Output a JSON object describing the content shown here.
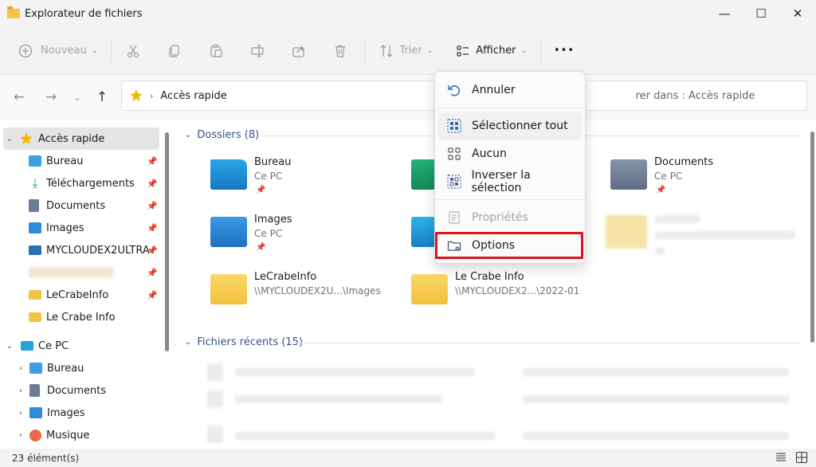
{
  "window": {
    "title": "Explorateur de fichiers",
    "minimize": "—",
    "maximize": "☐",
    "close": "✕"
  },
  "toolbar": {
    "new_label": "Nouveau",
    "sort_label": "Trier",
    "view_label": "Afficher",
    "more": "•••"
  },
  "address": {
    "path_label": "Accès rapide",
    "search_placeholder": "rer dans : Accès rapide"
  },
  "sidebar": {
    "quick_access": "Accès rapide",
    "quick_items": [
      {
        "label": "Bureau",
        "icon": "desktop-icon",
        "color": "#3aa0e0"
      },
      {
        "label": "Téléchargements",
        "icon": "download-icon",
        "color": "#1aa364"
      },
      {
        "label": "Documents",
        "icon": "document-icon",
        "color": "#6b7b95"
      },
      {
        "label": "Images",
        "icon": "images-icon",
        "color": "#2f8ad8"
      },
      {
        "label": "MYCLOUDEX2ULTRA",
        "icon": "network-drive-icon",
        "color": "#2a6fb5"
      },
      {
        "label": "",
        "icon": "folder-icon",
        "color": "#f6d36e"
      },
      {
        "label": "LeCrabeInfo",
        "icon": "folder-icon",
        "color": "#f6c343"
      },
      {
        "label": "Le Crabe Info",
        "icon": "folder-icon",
        "color": "#f6c343"
      }
    ],
    "this_pc": "Ce PC",
    "pc_items": [
      {
        "label": "Bureau",
        "icon": "desktop-icon",
        "color": "#3aa0e0"
      },
      {
        "label": "Documents",
        "icon": "document-icon",
        "color": "#6b7b95"
      },
      {
        "label": "Images",
        "icon": "images-icon",
        "color": "#2f8ad8"
      },
      {
        "label": "Musique",
        "icon": "music-icon",
        "color": "#e8684a"
      }
    ]
  },
  "content": {
    "folders_header": "Dossiers (8)",
    "recent_header": "Fichiers récents (15)",
    "folders": [
      {
        "name": "Bureau",
        "sub": "Ce PC",
        "icon": "desktop-folder-icon"
      },
      {
        "name": "Documents",
        "sub": "Ce PC",
        "icon": "documents-folder-icon"
      },
      {
        "name": "Images",
        "sub": "Ce PC",
        "icon": "images-folder-icon"
      },
      {
        "name": "LeCrabeInfo",
        "sub": "\\\\MYCLOUDEX2U...\\Images",
        "icon": "folder-icon"
      },
      {
        "name": "Le Crabe Info",
        "sub": "\\\\MYCLOUDEX2...\\2022-01",
        "icon": "folder-icon"
      }
    ]
  },
  "menu": {
    "items": [
      {
        "label": "Annuler",
        "icon": "undo-icon"
      },
      {
        "label": "Sélectionner tout",
        "icon": "select-all-icon"
      },
      {
        "label": "Aucun",
        "icon": "select-none-icon"
      },
      {
        "label": "Inverser la sélection",
        "icon": "invert-selection-icon"
      },
      {
        "label": "Propriétés",
        "icon": "properties-icon"
      },
      {
        "label": "Options",
        "icon": "options-icon"
      }
    ]
  },
  "status": {
    "count": "23 élément(s)"
  }
}
